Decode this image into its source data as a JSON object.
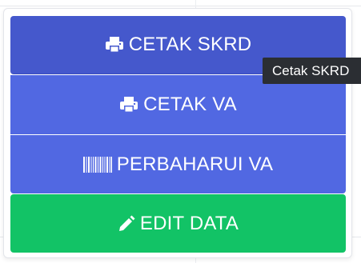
{
  "colors": {
    "skrd_button": "#4558cc",
    "va_button": "#5168e2",
    "perbaharui_button": "#5168e2",
    "edit_button": "#12c366",
    "tooltip_bg": "#2b2e33"
  },
  "menu": {
    "cetak_skrd": {
      "label": "CETAK SKRD",
      "icon": "printer-icon"
    },
    "cetak_va": {
      "label": "CETAK VA",
      "icon": "printer-icon"
    },
    "perbaharui_va": {
      "label": "PERBAHARUI VA",
      "icon": "barcode-icon"
    },
    "edit_data": {
      "label": "EDIT DATA",
      "icon": "pencil-icon"
    }
  },
  "tooltip": {
    "text": "Cetak SKRD"
  }
}
